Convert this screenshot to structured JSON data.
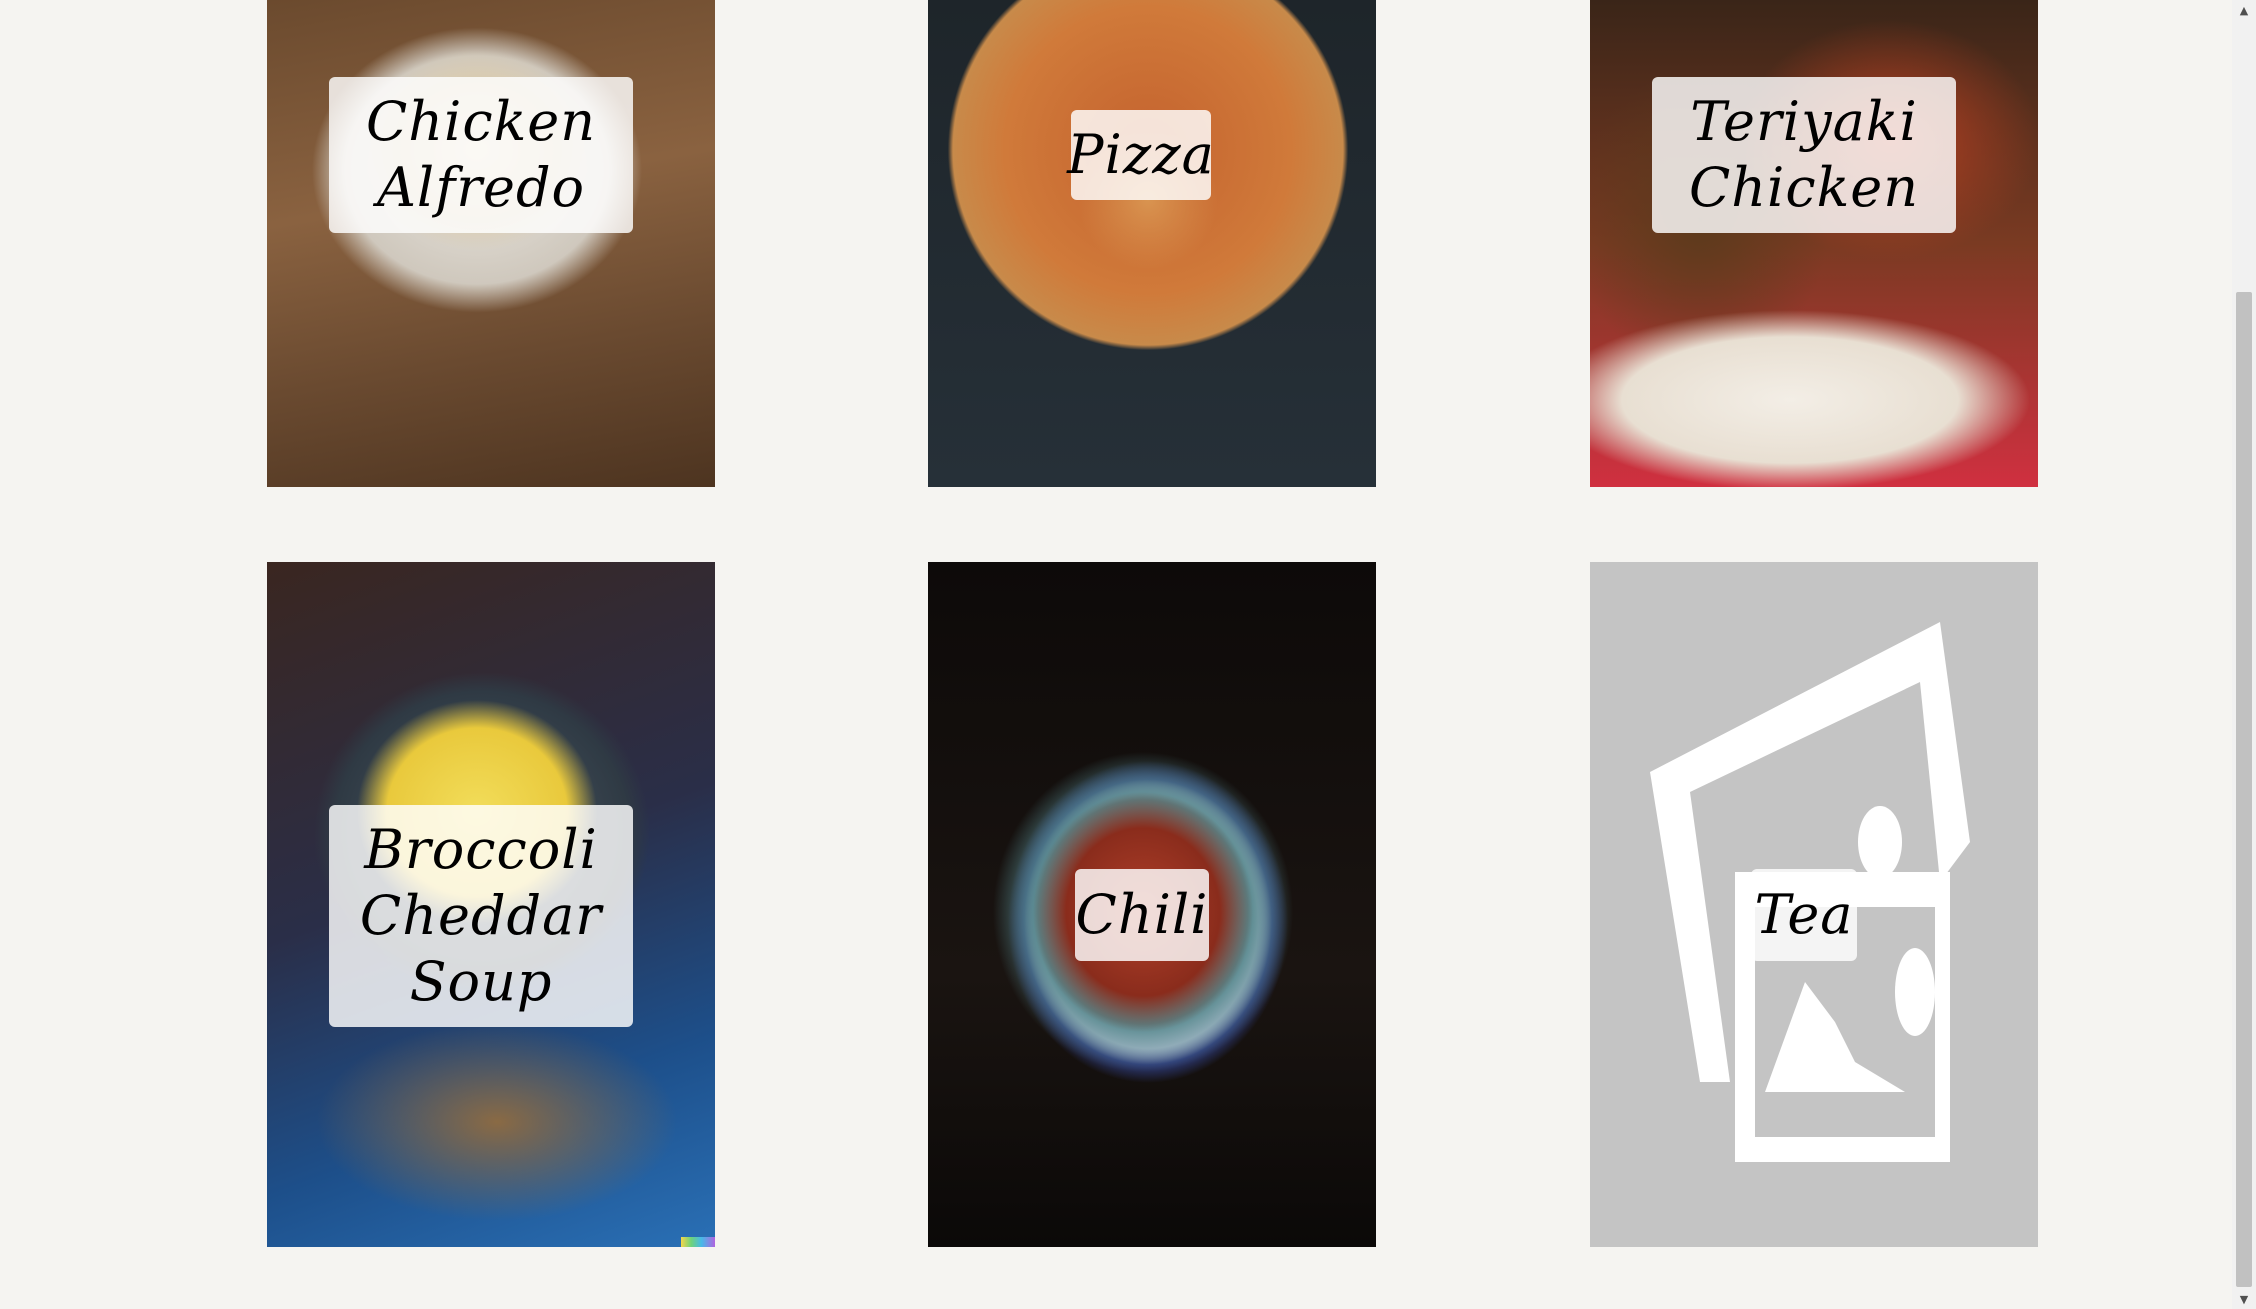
{
  "recipes": [
    {
      "name": "Chicken Alfredo",
      "lines": [
        "Chicken",
        "Alfredo"
      ]
    },
    {
      "name": "Pizza",
      "lines": [
        "Pizza"
      ]
    },
    {
      "name": "Teriyaki Chicken",
      "lines": [
        "Teriyaki",
        "Chicken"
      ]
    },
    {
      "name": "Broccoli Cheddar Soup",
      "lines": [
        "Broccoli",
        "Cheddar",
        "Soup"
      ]
    },
    {
      "name": "Chili",
      "lines": [
        "Chili"
      ]
    },
    {
      "name": "Tea",
      "lines": [
        "Tea"
      ]
    }
  ],
  "scrollbar": {
    "up_arrow": "▲",
    "down_arrow": "▼"
  },
  "icons": {
    "tea_image": "image-placeholder-icon"
  },
  "colors": {
    "page_background": "#f5f4f1",
    "placeholder_background": "#c4c4c4",
    "label_background": "rgba(255,255,255,0.82)"
  }
}
